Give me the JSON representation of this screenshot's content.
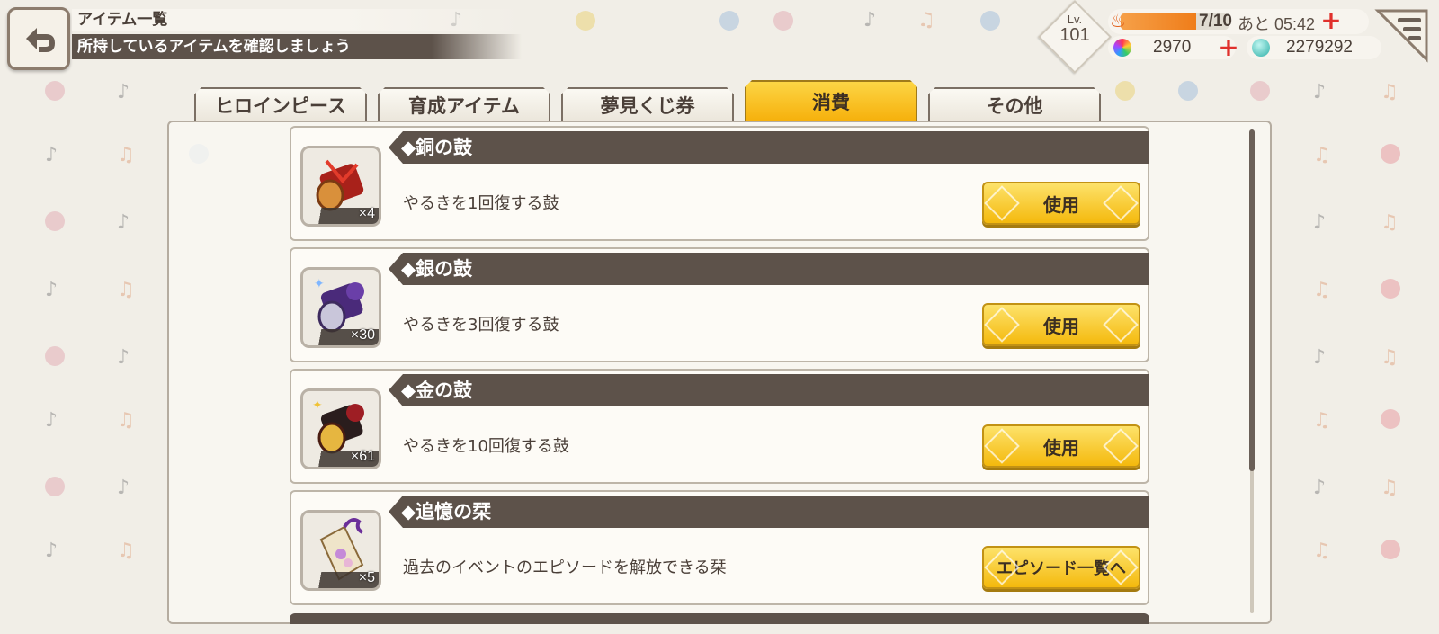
{
  "header": {
    "title": "アイテム一覧",
    "subtitle": "所持しているアイテムを確認しましょう"
  },
  "status": {
    "level_label": "Lv.",
    "level": "101",
    "stamina": "7/10",
    "stamina_fraction": 0.7,
    "stamina_timer": "あと 05:42",
    "gems_rainbow": "2970",
    "gems_blue": "2279292"
  },
  "tabs": [
    {
      "label": "ヒロインピース",
      "active": false
    },
    {
      "label": "育成アイテム",
      "active": false
    },
    {
      "label": "夢見くじ券",
      "active": false
    },
    {
      "label": "消費",
      "active": true
    },
    {
      "label": "その他",
      "active": false
    }
  ],
  "items": [
    {
      "name": "◆銅の鼓",
      "description": "やるきを1回復する鼓",
      "count": "×4",
      "action": "使用",
      "icon": "copper-drum-icon"
    },
    {
      "name": "◆銀の鼓",
      "description": "やるきを3回復する鼓",
      "count": "×30",
      "action": "使用",
      "icon": "silver-drum-icon"
    },
    {
      "name": "◆金の鼓",
      "description": "やるきを10回復する鼓",
      "count": "×61",
      "action": "使用",
      "icon": "gold-drum-icon"
    },
    {
      "name": "◆追憶の栞",
      "description": "過去のイベントのエピソードを解放できる栞",
      "count": "×5",
      "action": "エピソード一覧へ",
      "icon": "bookmark-icon"
    }
  ],
  "colors": {
    "accent": "#f6b00b",
    "header_bar": "#5d524a",
    "stamina": "#ef7d1a",
    "plus": "#e0302c"
  }
}
